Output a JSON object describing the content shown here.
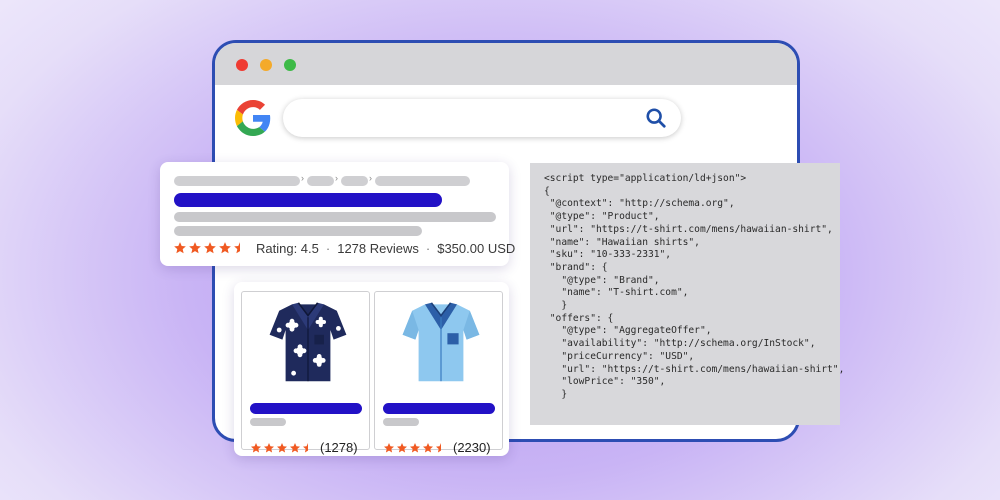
{
  "window": {
    "controls": [
      "close",
      "minimize",
      "maximize"
    ]
  },
  "search": {
    "logo_icon": "google-g-icon",
    "search_icon": "magnifier-icon",
    "query": ""
  },
  "result": {
    "rating_text": "Rating: 4.5",
    "reviews_text": "1278 Reviews",
    "price_text": "$350.00 USD",
    "separator": "·",
    "stars": 4.5
  },
  "products": [
    {
      "image": "hawaiian-shirt-navy-floral",
      "rating_count": "(1278)",
      "stars": 4.5
    },
    {
      "image": "shirt-light-blue",
      "rating_count": "(2230)",
      "stars": 4.5
    }
  ],
  "code": {
    "lines": [
      "<script type=\"application/ld+json\">",
      "{",
      " \"@context\": \"http://schema.org\",",
      " \"@type\": \"Product\",",
      " \"url\": \"https://t-shirt.com/mens/hawaiian-shirt\",",
      " \"name\": \"Hawaiian shirts\",",
      " \"sku\": \"10-333-2331\",",
      " \"brand\": {",
      "   \"@type\": \"Brand\",",
      "   \"name\": \"T-shirt.com\",",
      "   }",
      " \"offers\": {",
      "   \"@type\": \"AggregateOffer\",",
      "   \"availability\": \"http://schema.org/InStock\",",
      "   \"priceCurrency\": \"USD\",",
      "   \"url\": \"https://t-shirt.com/mens/hawaiian-shirt\",",
      "   \"lowPrice\": \"350\",",
      "   }"
    ]
  },
  "colors": {
    "window_border": "#2d4db3",
    "link_blue": "#2211c6",
    "star": "#f05a22",
    "code_bg": "#d8d8db"
  }
}
